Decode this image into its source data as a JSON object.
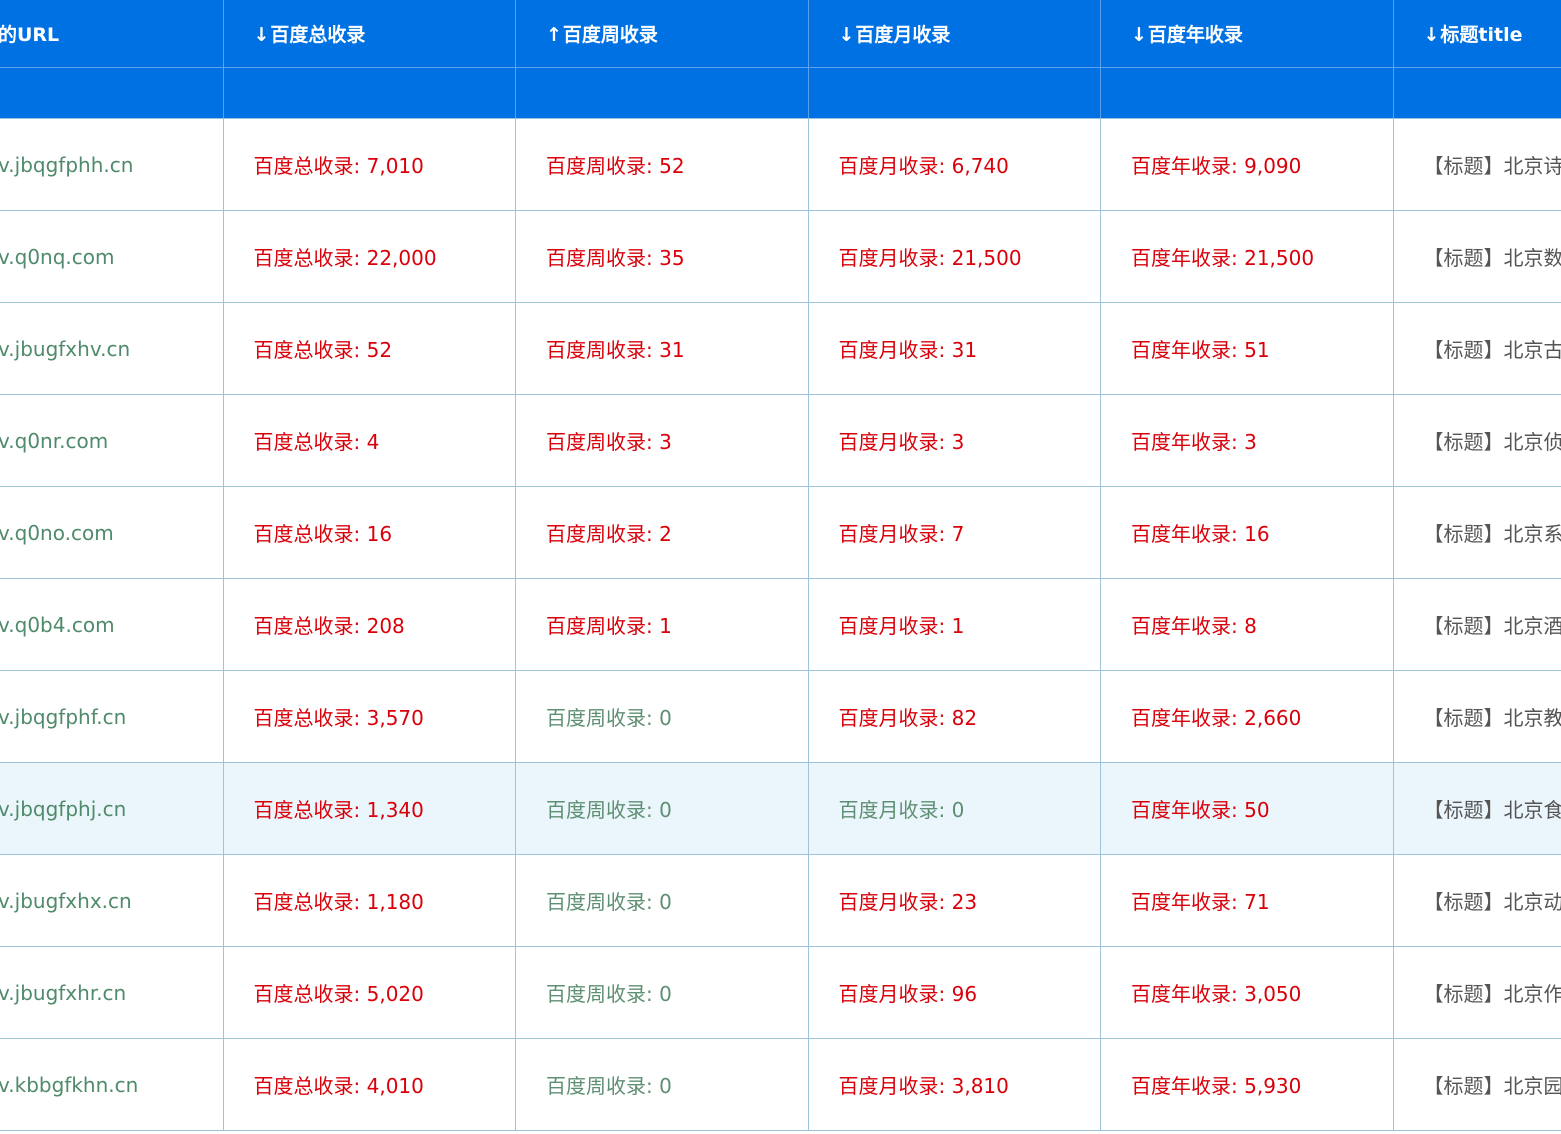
{
  "header": {
    "col_url": "的URL",
    "col_total": "百度总收录",
    "col_week": "百度周收录",
    "col_month": "百度月收录",
    "col_year": "百度年收录",
    "col_title": "标题title",
    "arrow_down": "↓",
    "arrow_up": "↑"
  },
  "labels": {
    "total": "百度总收录: ",
    "week": "百度周收录: ",
    "month": "百度月收录: ",
    "year": "百度年收录: "
  },
  "colors": {
    "header_bg": "#0071e3",
    "positive": "#d9000a",
    "zero": "#5e8f72",
    "url": "#4f8a6a",
    "highlight_row": "#ebf6fc"
  },
  "rows": [
    {
      "url": "v.jbqgfphh.cn",
      "total": "7,010",
      "week": "52",
      "month": "6,740",
      "year": "9,090",
      "title": "【标题】北京诗"
    },
    {
      "url": "v.q0nq.com",
      "total": "22,000",
      "week": "35",
      "month": "21,500",
      "year": "21,500",
      "title": "【标题】北京数"
    },
    {
      "url": "v.jbugfxhv.cn",
      "total": "52",
      "week": "31",
      "month": "31",
      "year": "51",
      "title": "【标题】北京古"
    },
    {
      "url": "v.q0nr.com",
      "total": "4",
      "week": "3",
      "month": "3",
      "year": "3",
      "title": "【标题】北京侦"
    },
    {
      "url": "v.q0no.com",
      "total": "16",
      "week": "2",
      "month": "7",
      "year": "16",
      "title": "【标题】北京系"
    },
    {
      "url": "v.q0b4.com",
      "total": "208",
      "week": "1",
      "month": "1",
      "year": "8",
      "title": "【标题】北京酒"
    },
    {
      "url": "v.jbqgfphf.cn",
      "total": "3,570",
      "week": "0",
      "month": "82",
      "year": "2,660",
      "title": "【标题】北京教"
    },
    {
      "url": "v.jbqgfphj.cn",
      "total": "1,340",
      "week": "0",
      "month": "0",
      "year": "50",
      "title": "【标题】北京食",
      "highlight": true
    },
    {
      "url": "v.jbugfxhx.cn",
      "total": "1,180",
      "week": "0",
      "month": "23",
      "year": "71",
      "title": "【标题】北京动"
    },
    {
      "url": "v.jbugfxhr.cn",
      "total": "5,020",
      "week": "0",
      "month": "96",
      "year": "3,050",
      "title": "【标题】北京作"
    },
    {
      "url": "v.kbbgfkhn.cn",
      "total": "4,010",
      "week": "0",
      "month": "3,810",
      "year": "5,930",
      "title": "【标题】北京园"
    }
  ]
}
